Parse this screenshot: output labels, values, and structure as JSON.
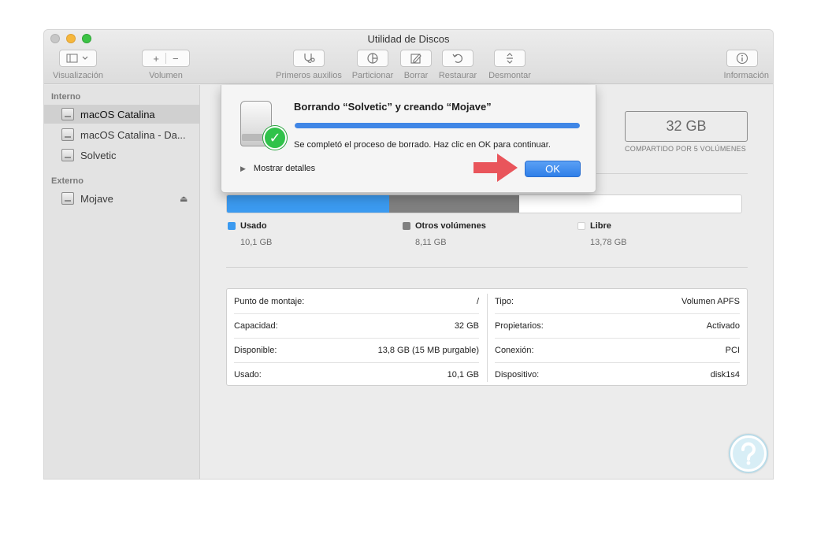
{
  "window": {
    "title": "Utilidad de Discos"
  },
  "toolbar": {
    "visualizacion": "Visualización",
    "volumen": "Volumen",
    "add_symbol": "+",
    "remove_symbol": "−",
    "primeros_auxilios": "Primeros auxilios",
    "particionar": "Particionar",
    "borrar": "Borrar",
    "restaurar": "Restaurar",
    "desmontar": "Desmontar",
    "informacion": "Información"
  },
  "sidebar": {
    "interno_header": "Interno",
    "externo_header": "Externo",
    "interno_items": [
      {
        "label": "macOS Catalina",
        "selected": true
      },
      {
        "label": "macOS Catalina - Da...",
        "selected": false
      },
      {
        "label": "Solvetic",
        "selected": false
      }
    ],
    "externo_items": [
      {
        "label": "Mojave",
        "eject": "⏏"
      }
    ]
  },
  "capacity": {
    "value": "32 GB",
    "shared": "COMPARTIDO POR 5 VOLÚMENES"
  },
  "usage": {
    "used_fraction": 0.316,
    "other_fraction": 0.253,
    "free_fraction": 0.431,
    "colors": {
      "used": "#3b9af0",
      "other": "#808080",
      "free": "#ffffff"
    },
    "legend": [
      {
        "name": "Usado",
        "value": "10,1 GB",
        "color": "#3b9af0"
      },
      {
        "name": "Otros volúmenes",
        "value": "8,11 GB",
        "color": "#808080"
      },
      {
        "name": "Libre",
        "value": "13,78 GB",
        "color": "#ffffff"
      }
    ]
  },
  "info": {
    "left": [
      {
        "label": "Punto de montaje:",
        "value": "/"
      },
      {
        "label": "Capacidad:",
        "value": "32 GB"
      },
      {
        "label": "Disponible:",
        "value": "13,8 GB (15 MB purgable)"
      },
      {
        "label": "Usado:",
        "value": "10,1 GB"
      }
    ],
    "right": [
      {
        "label": "Tipo:",
        "value": "Volumen APFS"
      },
      {
        "label": "Propietarios:",
        "value": "Activado"
      },
      {
        "label": "Conexión:",
        "value": "PCI"
      },
      {
        "label": "Dispositivo:",
        "value": "disk1s4"
      }
    ]
  },
  "dialog": {
    "title": "Borrando “Solvetic” y creando “Mojave”",
    "progress": 1.0,
    "message": "Se completó el proceso de borrado. Haz clic en OK para continuar.",
    "details_label": "Mostrar detalles",
    "ok_label": "OK",
    "check_symbol": "✓",
    "disclosure_symbol": "▶"
  },
  "colors": {
    "accent": "#3f86e6",
    "arrow": "#e9555b"
  }
}
